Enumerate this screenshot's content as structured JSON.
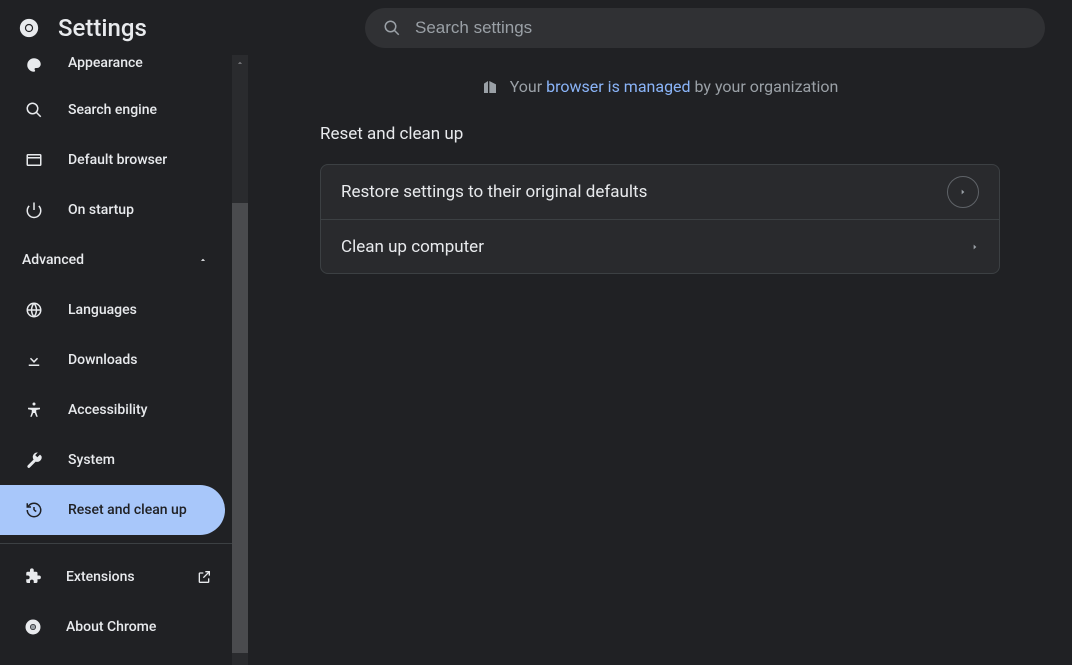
{
  "header": {
    "title": "Settings",
    "search_placeholder": "Search settings"
  },
  "sidebar": {
    "basic": [
      {
        "icon": "paint",
        "label": "Appearance"
      },
      {
        "icon": "search",
        "label": "Search engine"
      },
      {
        "icon": "browser",
        "label": "Default browser"
      },
      {
        "icon": "power",
        "label": "On startup"
      }
    ],
    "advanced_label": "Advanced",
    "advanced": [
      {
        "icon": "globe",
        "label": "Languages"
      },
      {
        "icon": "download",
        "label": "Downloads"
      },
      {
        "icon": "accessibility",
        "label": "Accessibility"
      },
      {
        "icon": "wrench",
        "label": "System"
      },
      {
        "icon": "restore",
        "label": "Reset and clean up",
        "active": true
      }
    ],
    "footer": [
      {
        "icon": "extension",
        "label": "Extensions",
        "external": true
      },
      {
        "icon": "chrome",
        "label": "About Chrome"
      }
    ]
  },
  "main": {
    "managed_prefix": "Your ",
    "managed_link": "browser is managed",
    "managed_suffix": " by your organization",
    "section_title": "Reset and clean up",
    "rows": [
      {
        "label": "Restore settings to their original defaults"
      },
      {
        "label": "Clean up computer"
      }
    ]
  }
}
